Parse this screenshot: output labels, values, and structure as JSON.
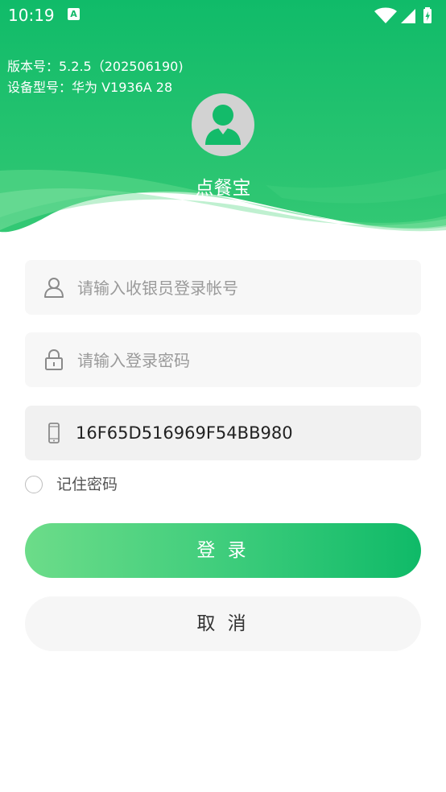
{
  "status_bar": {
    "time": "10:19",
    "notification_icon_letter": "A",
    "icons": [
      "wifi-icon",
      "cell-signal-icon",
      "battery-charging-icon"
    ]
  },
  "header": {
    "version": "版本号：5.2.5（202506190)",
    "device_model": "设备型号：华为 V1936A 28",
    "app_name": "点餐宝",
    "gradient_top": "#13bd6b",
    "gradient_bottom": "#2ec773"
  },
  "form": {
    "account_placeholder": "请输入收银员登录帐号",
    "account_value": "",
    "password_placeholder": "请输入登录密码",
    "password_value": "",
    "device_id": "16F65D516969F54BB980",
    "remember_label": "记住密码",
    "remember_checked": false
  },
  "buttons": {
    "login": "登 录",
    "cancel": "取 消"
  },
  "colors": {
    "brand_green": "#13bb6a",
    "login_gradient_start": "#6cdc89",
    "login_gradient_end": "#0fba68"
  }
}
